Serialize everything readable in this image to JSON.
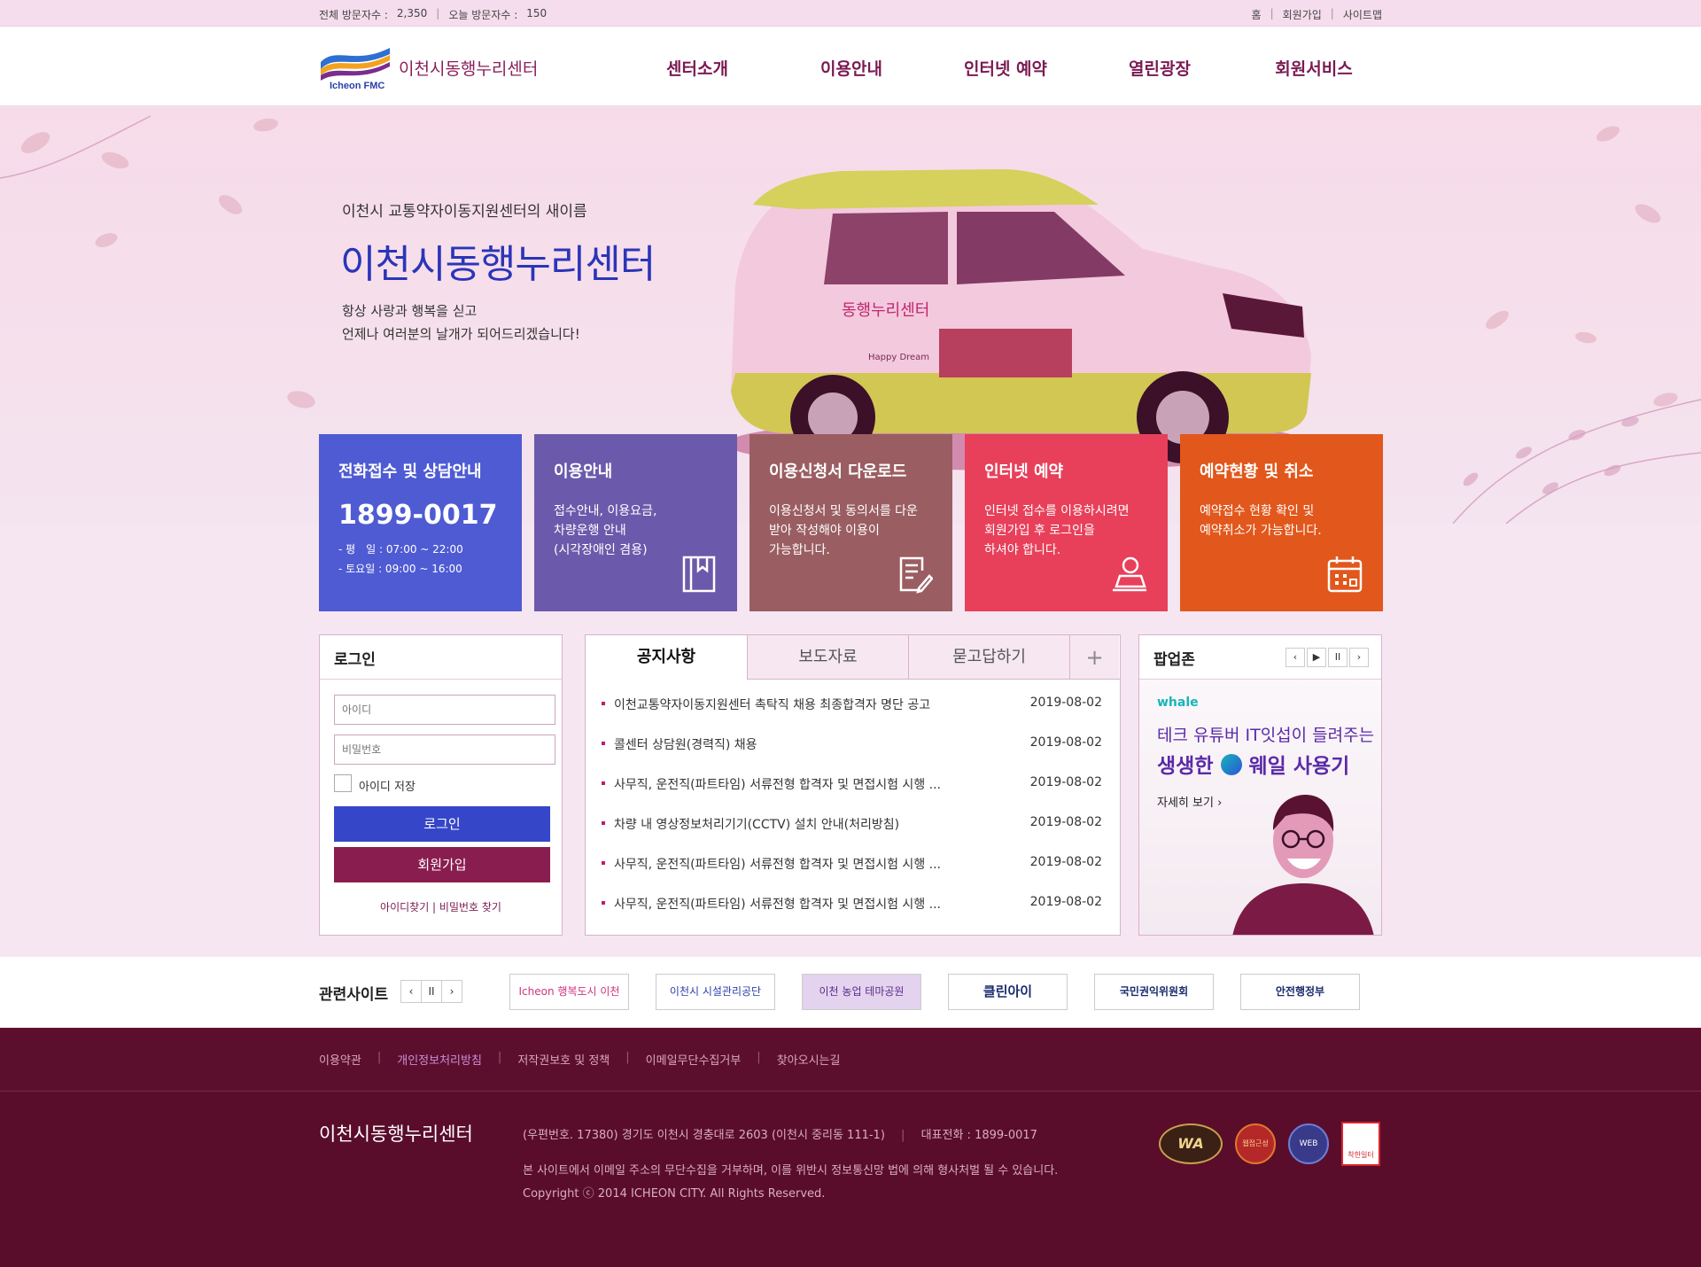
{
  "topbar": {
    "total_visitors_label": "전체 방문자수 :",
    "total_visitors": "2,350",
    "today_visitors_label": "오늘 방문자수 :",
    "today_visitors": "150",
    "links": [
      "홈",
      "회원가입",
      "사이트맵"
    ]
  },
  "header": {
    "logo_text": "Icheon FMC",
    "site_name": "이천시동행누리센터",
    "nav": [
      "센터소개",
      "이용안내",
      "인터넷 예약",
      "열린광장",
      "회원서비스"
    ]
  },
  "hero": {
    "subtitle": "이천시 교통약자이동지원센터의 새이름",
    "title": "이천시동행누리센터",
    "desc": [
      "항상 사랑과 행복을 싣고",
      "언제나 여러분의 날개가 되어드리겠습니다!"
    ],
    "car_text": [
      "동행누리센터",
      "Happy Dream"
    ]
  },
  "quick": [
    {
      "title": "전화접수 및 상담안내",
      "phone": "1899-0017",
      "hours": [
        "- 평　일 : 07:00 ~ 22:00",
        "- 토요일 : 09:00 ~ 16:00"
      ],
      "color": "#4f5bd3"
    },
    {
      "title": "이용안내",
      "desc": [
        "접수안내, 이용요금,",
        "차량운행 안내",
        "(시각장애인 겸용)"
      ],
      "color": "#6b5aab"
    },
    {
      "title": "이용신청서 다운로드",
      "desc": [
        "이용신청서 및 동의서를 다운",
        "받아 작성해야 이용이",
        "가능합니다."
      ],
      "color": "#9a5e62"
    },
    {
      "title": "인터넷 예약",
      "desc": [
        "인터넷 접수를 이용하시려면",
        "회원가입 후 로그인을",
        "하셔야 합니다."
      ],
      "color": "#e8405a"
    },
    {
      "title": "예약현황 및 취소",
      "desc": [
        "예약접수 현황 확인 및",
        "예약취소가 가능합니다."
      ],
      "color": "#e2571b"
    }
  ],
  "login": {
    "title": "로그인",
    "id_placeholder": "아이디",
    "pw_placeholder": "비밀번호",
    "save_id": "아이디 저장",
    "login_btn": "로그인",
    "join_btn": "회원가입",
    "find": "아이디찾기 | 비밀번호 찾기"
  },
  "board": {
    "tabs": [
      "공지사항",
      "보도자료",
      "묻고답하기"
    ],
    "more": "+",
    "items": [
      {
        "title": "이천교통약자이동지원센터 촉탁직 채용 최종합격자 명단 공고",
        "date": "2019-08-02"
      },
      {
        "title": "콜센터 상담원(경력직) 채용",
        "date": "2019-08-02"
      },
      {
        "title": "사무직, 운전직(파트타임) 서류전형 합격자 및 면접시험 시행 ...",
        "date": "2019-08-02"
      },
      {
        "title": "차량 내 영상정보처리기기(CCTV) 설치 안내(처리방침)",
        "date": "2019-08-02"
      },
      {
        "title": "사무직, 운전직(파트타임) 서류전형 합격자 및 면접시험 시행 ...",
        "date": "2019-08-02"
      },
      {
        "title": "사무직, 운전직(파트타임) 서류전형 합격자 및 면접시험 시행 ...",
        "date": "2019-08-02"
      }
    ]
  },
  "popup": {
    "title": "팝업존",
    "controls": [
      "‹",
      "▶",
      "II",
      "›"
    ],
    "brand": "whale",
    "line1": "테크 유튜버 IT잇섭이 들려주는",
    "line2a": "생생한",
    "line2b": "웨일 사용기",
    "more": "자세히 보기 ›"
  },
  "related": {
    "label": "관련사이트",
    "controls": [
      "‹",
      "II",
      "›"
    ],
    "banners": [
      "Icheon 행복도시 이천",
      "이천시 시설관리공단",
      "이천 농업 테마공원",
      "클린아이",
      "국민권익위원회",
      "안전행정부"
    ]
  },
  "footer": {
    "links": [
      "이용약관",
      "개인정보처리방침",
      "저작권보호 및 정책",
      "이메일무단수집거부",
      "찾아오시는길"
    ],
    "name": "이천시동행누리센터",
    "address": "(우편번호. 17380) 경기도 이천시 경충대로 2603 (이천시 중리동 111-1)",
    "tel_label": "대표전화 : 1899-0017",
    "note": "본 사이트에서 이메일 주소의 무단수집을 거부하며, 이를 위반시 정보통신망 법에 의해 형사처벌 될 수 있습니다.",
    "copyright": "Copyright ⓒ 2014 ICHEON CITY. All Rights Reserved.",
    "marks": [
      "WA",
      "웹접근성",
      "WEB",
      "착한일터"
    ]
  }
}
